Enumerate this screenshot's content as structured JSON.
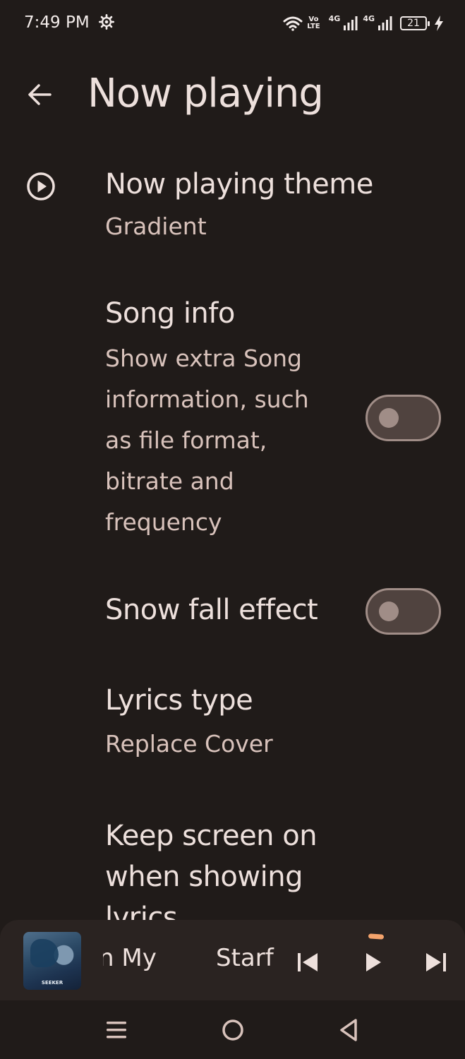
{
  "status_bar": {
    "time": "7:49 PM",
    "icons": [
      "gear-icon",
      "wifi-icon",
      "volte-icon",
      "signal-icon",
      "signal-icon",
      "battery-icon",
      "charging-icon"
    ],
    "volte_top": "Vo",
    "volte_bottom": "LTE",
    "net1": "4G",
    "net2": "4G",
    "battery": "21"
  },
  "app_bar": {
    "title": "Now playing"
  },
  "settings": [
    {
      "title": "Now playing theme",
      "subtitle": "Gradient",
      "icon": "play-circle-icon"
    },
    {
      "title": "Song info",
      "subtitle": "Show extra Song information, such as file format, bitrate and frequency",
      "toggle": false
    },
    {
      "title": "Snow fall effect",
      "toggle": false
    },
    {
      "title": "Lyrics type",
      "subtitle": "Replace Cover"
    },
    {
      "title": "Keep screen on when showing lyrics"
    }
  ],
  "mini_player": {
    "album_label": "SEEKER",
    "track_text_a": "n My",
    "track_text_b": "Starf",
    "progress": 0.02,
    "colors": {
      "progress": "#f4a36c"
    }
  },
  "colors": {
    "background": "#201b19",
    "text": "#ede0dc",
    "subtext": "#d8c2bb",
    "toggle_track": "#50433f",
    "toggle_outline": "#a08d87"
  }
}
